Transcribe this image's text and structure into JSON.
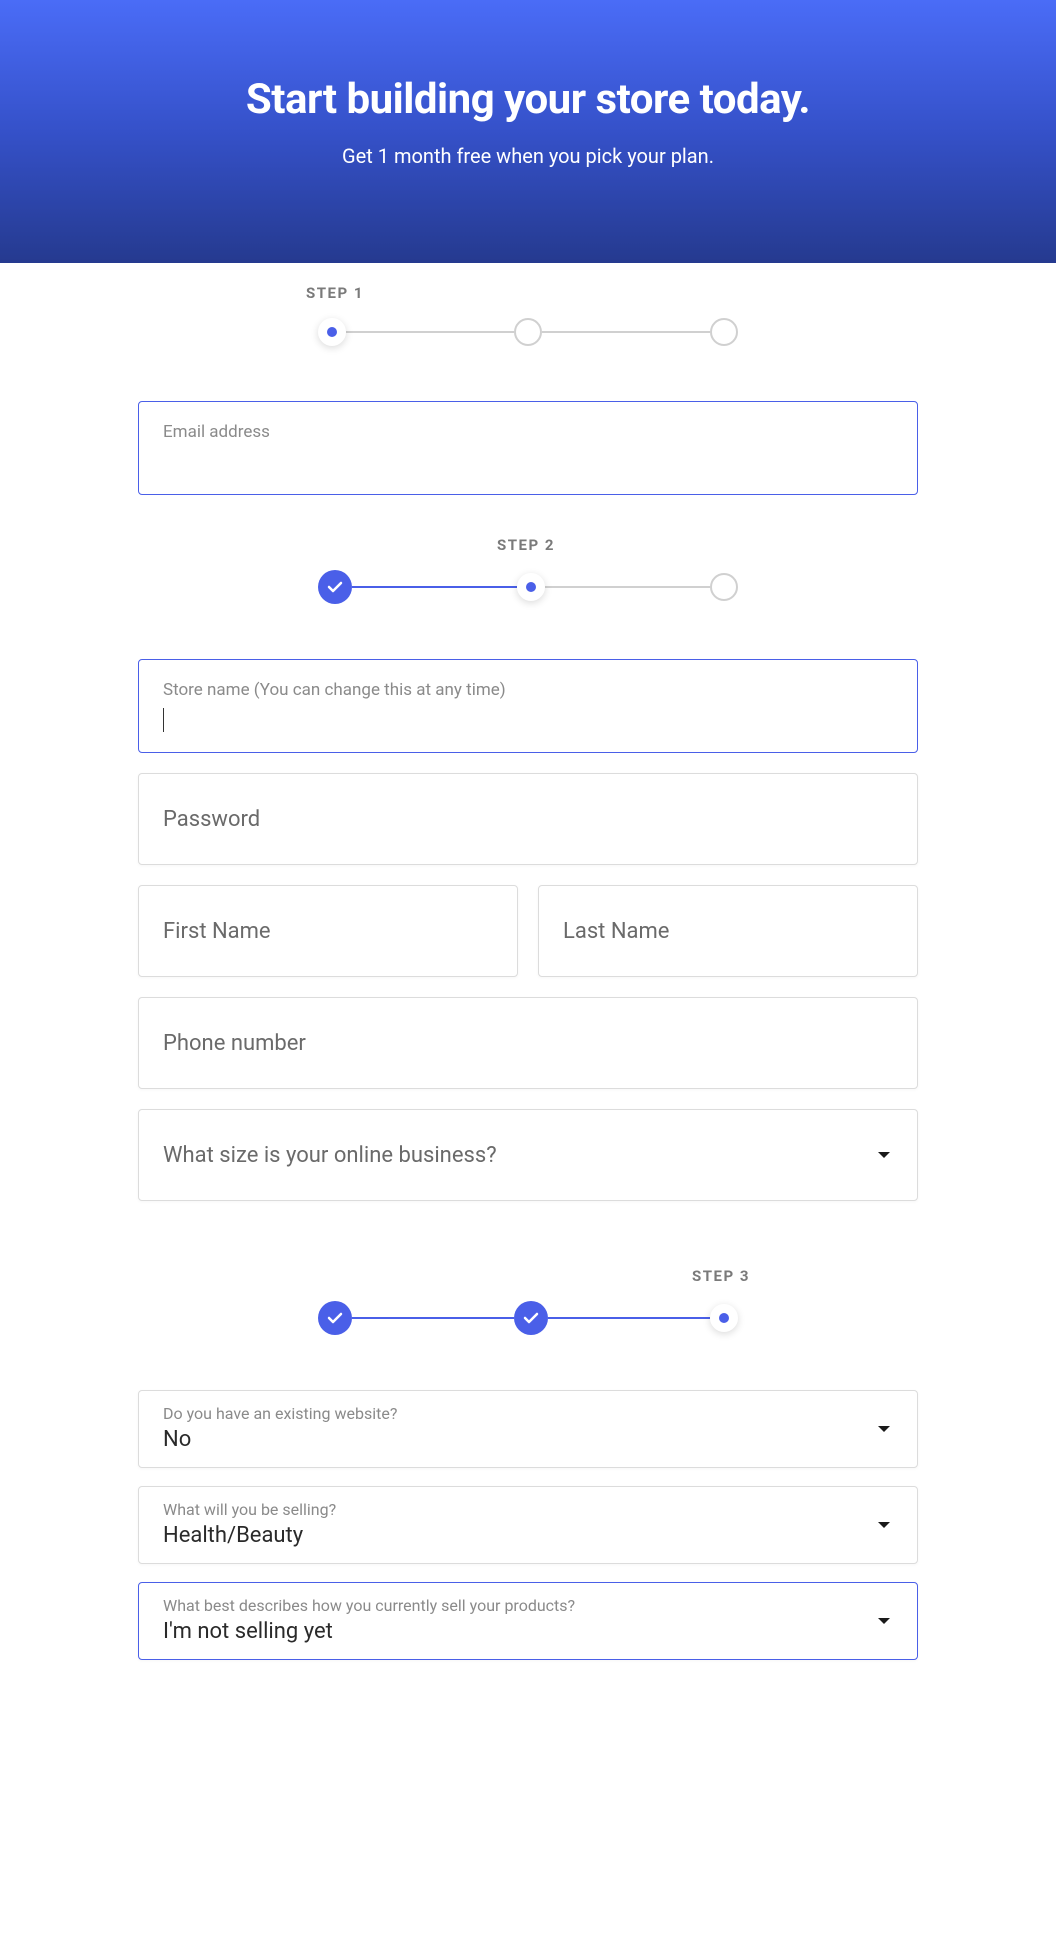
{
  "hero": {
    "title": "Start building your store today.",
    "subtitle": "Get 1 month free when you pick your plan."
  },
  "steps": {
    "step1_label": "STEP 1",
    "step2_label": "STEP 2",
    "step3_label": "STEP 3"
  },
  "step1": {
    "email_label": "Email address"
  },
  "step2": {
    "store_name_label": "Store name (You can change this at any time)",
    "password_label": "Password",
    "first_name_label": "First Name",
    "last_name_label": "Last Name",
    "phone_label": "Phone number",
    "size_label": "What size is your online business?"
  },
  "step3": {
    "existing_label": "Do you have an existing website?",
    "existing_value": "No",
    "selling_label": "What will you be selling?",
    "selling_value": "Health/Beauty",
    "describes_label": "What best describes how you currently sell your products?",
    "describes_value": "I'm not selling yet"
  }
}
